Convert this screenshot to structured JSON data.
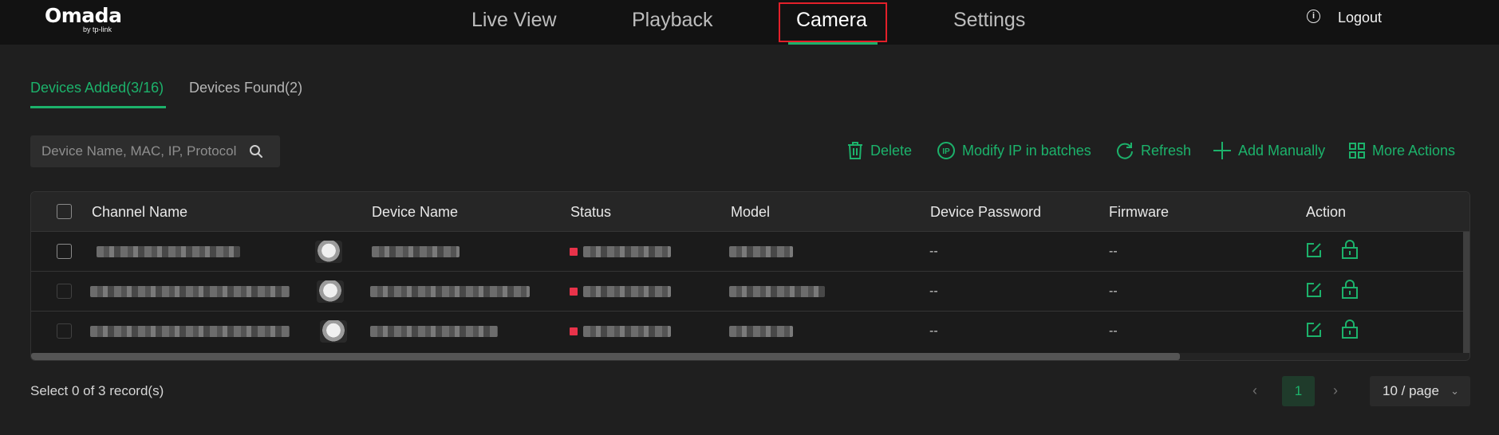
{
  "app": {
    "brand": "Omada",
    "brand_sub": "by tp-link"
  },
  "nav": {
    "items": [
      {
        "label": "Live View"
      },
      {
        "label": "Playback"
      },
      {
        "label": "Camera"
      },
      {
        "label": "Settings"
      }
    ],
    "active": "Camera",
    "logout": "Logout"
  },
  "tabs": [
    {
      "label": "Devices Added(3/16)",
      "active": true
    },
    {
      "label": "Devices Found(2)",
      "active": false
    }
  ],
  "search": {
    "placeholder": "Device Name, MAC, IP, Protocol",
    "value": ""
  },
  "actions": {
    "delete": "Delete",
    "modify_ip": "Modify IP in batches",
    "refresh": "Refresh",
    "add_manually": "Add Manually",
    "more_actions": "More Actions"
  },
  "table": {
    "columns": [
      "Channel Name",
      "Device Name",
      "Status",
      "Model",
      "Device Password",
      "Firmware",
      "Action"
    ],
    "rows": [
      {
        "device_password": "--",
        "firmware": "--"
      },
      {
        "device_password": "--",
        "firmware": "--"
      },
      {
        "device_password": "--",
        "firmware": "--"
      }
    ]
  },
  "footer": {
    "selected_info": "Select 0 of 3 record(s)",
    "current_page": "1",
    "page_size": "10 / page"
  },
  "colors": {
    "accent": "#1cb26b",
    "highlight_box": "#e3202a",
    "status_offline": "#e8334a",
    "topbar_bg": "#121212",
    "page_bg": "#1f1f1f"
  }
}
